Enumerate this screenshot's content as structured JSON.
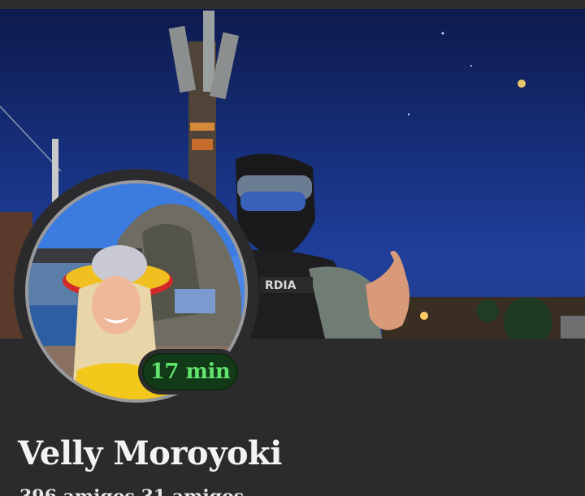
{
  "profile": {
    "name": "Velly Moroyoki",
    "last_active": "17 min",
    "stats_line": "396 amigos   31 amigos"
  },
  "colors": {
    "background": "#2b2b2d",
    "badge_bg": "#123a18",
    "badge_text": "#62e36c",
    "ring": "#9a9a9c"
  },
  "icons": {
    "cover": "cover-photo",
    "avatar": "profile-photo"
  }
}
